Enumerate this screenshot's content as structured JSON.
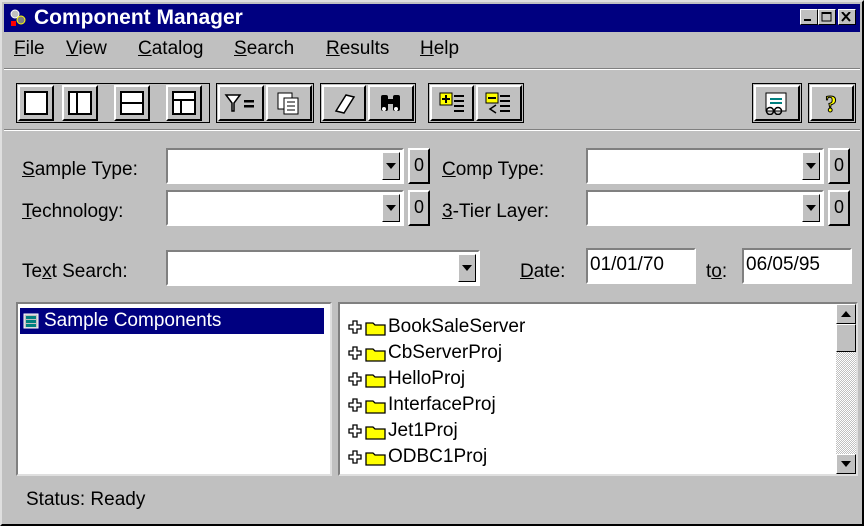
{
  "window": {
    "title": "Component Manager",
    "titlebar_color": "#000080"
  },
  "menu": [
    {
      "label": "File",
      "accel": "F",
      "rest": "ile"
    },
    {
      "label": "View",
      "accel": "V",
      "rest": "iew"
    },
    {
      "label": "Catalog",
      "accel": "C",
      "rest": "atalog"
    },
    {
      "label": "Search",
      "accel": "S",
      "rest": "earch"
    },
    {
      "label": "Results",
      "accel": "R",
      "rest": "esults"
    },
    {
      "label": "Help",
      "accel": "H",
      "rest": "elp"
    }
  ],
  "toolbar": {
    "icons": [
      "single-pane-icon",
      "two-pane-vertical-icon",
      "two-pane-horizontal-icon",
      "three-pane-icon",
      "filter-icon",
      "copy-icon",
      "eraser-icon",
      "binoculars-icon",
      "expand-list-icon",
      "collapse-list-icon",
      "preview-icon",
      "help-icon"
    ]
  },
  "form": {
    "sample_type": {
      "label_accel": "S",
      "label_rest": "ample Type:",
      "value": "",
      "count": "0"
    },
    "comp_type": {
      "label_accel": "C",
      "label_rest": "omp Type:",
      "value": "",
      "count": "0"
    },
    "technology": {
      "label_accel": "T",
      "label_rest": "echnology:",
      "value": "",
      "count": "0"
    },
    "tier_layer": {
      "label_accel": "3",
      "label_rest": "-Tier Layer:",
      "value": "",
      "count": "0"
    },
    "text_search": {
      "label_pre": "Te",
      "label_accel": "x",
      "label_rest": "t Search:",
      "value": ""
    },
    "date": {
      "label_accel": "D",
      "label_rest": "ate:",
      "from": "01/01/70",
      "to_label_pre": "t",
      "to_label_accel": "o",
      "to_label_rest": ":",
      "to": "06/05/95"
    }
  },
  "left_panel": {
    "selected_item": "Sample Components",
    "selection_color": "#000080"
  },
  "right_panel": {
    "folders": [
      "BookSaleServer",
      "CbServerProj",
      "HelloProj",
      "InterfaceProj",
      "Jet1Proj",
      "ODBC1Proj"
    ],
    "folder_color": "#ffff00"
  },
  "status": {
    "text": "Status: Ready"
  }
}
